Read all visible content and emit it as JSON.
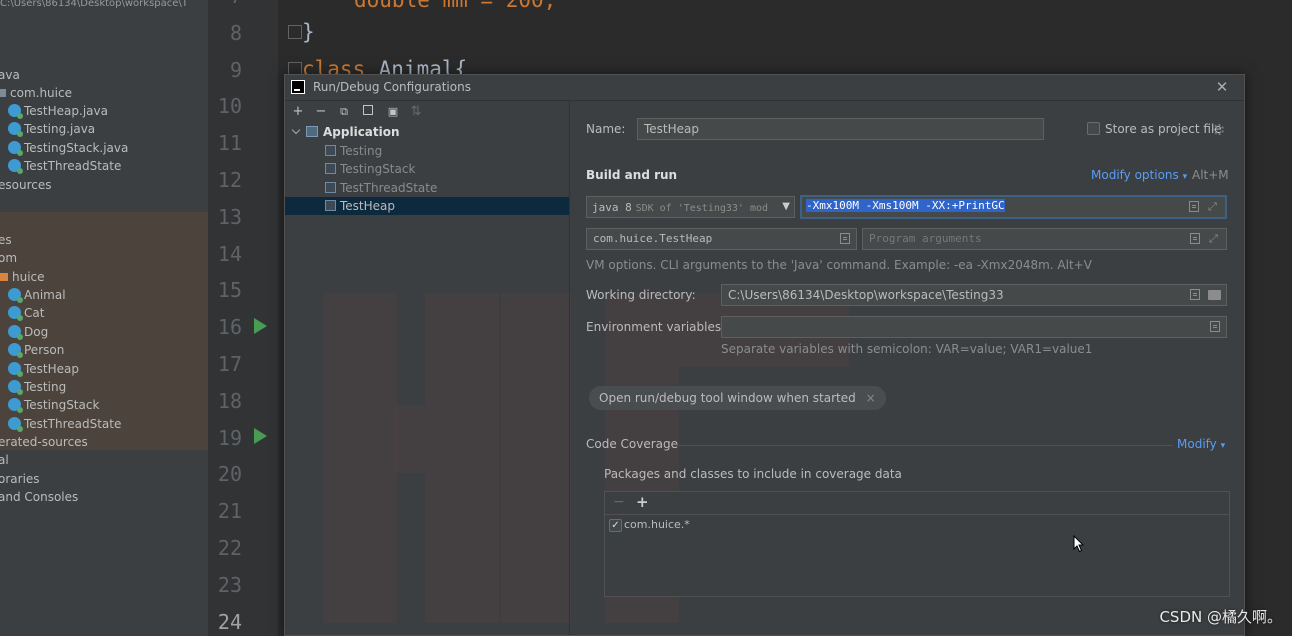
{
  "project_tree": {
    "path_text": "C:\\Users\\86134\\Desktop\\workspace\\T",
    "rows": [
      {
        "text": "ava",
        "kind": "plain"
      },
      {
        "text": "com.huice",
        "kind": "plain"
      },
      {
        "text": "TestHeap.java",
        "kind": "java"
      },
      {
        "text": "Testing.java",
        "kind": "java"
      },
      {
        "text": "TestingStack.java",
        "kind": "java"
      },
      {
        "text": "TestThreadState",
        "kind": "java"
      },
      {
        "text": "esources",
        "kind": "plain"
      },
      {
        "text": "es",
        "kind": "plain"
      },
      {
        "text": "om",
        "kind": "plain"
      },
      {
        "text": "huice",
        "kind": "folder"
      },
      {
        "text": "Animal",
        "kind": "java"
      },
      {
        "text": "Cat",
        "kind": "java"
      },
      {
        "text": "Dog",
        "kind": "java"
      },
      {
        "text": "Person",
        "kind": "java"
      },
      {
        "text": "TestHeap",
        "kind": "java"
      },
      {
        "text": "Testing",
        "kind": "java"
      },
      {
        "text": "TestingStack",
        "kind": "java"
      },
      {
        "text": "TestThreadState",
        "kind": "java"
      },
      {
        "text": "erated-sources",
        "kind": "plain"
      },
      {
        "text": "al",
        "kind": "plain"
      },
      {
        "text": "oraries",
        "kind": "plain"
      },
      {
        "text": "and Consoles",
        "kind": "plain"
      }
    ]
  },
  "editor": {
    "line_numbers": [
      "7",
      "8",
      "9",
      "10",
      "11",
      "12",
      "13",
      "14",
      "15",
      "16",
      "17",
      "18",
      "19",
      "20",
      "21",
      "22",
      "23",
      "24"
    ],
    "code_top": "double mm = 200;",
    "code_brace": "}",
    "code_class_kw": "class",
    "code_class_name": " Animal{"
  },
  "dialog": {
    "title": "Run/Debug Configurations",
    "close_glyph": "✕",
    "toolbar": {
      "add": "+",
      "remove": "−",
      "copy": "⧉",
      "save": "💾",
      "folder": "▣",
      "sort": "⇅"
    },
    "tree": {
      "group": "Application",
      "items": [
        "Testing",
        "TestingStack",
        "TestThreadState",
        "TestHeap"
      ],
      "selected": "TestHeap"
    },
    "form": {
      "name_label": "Name:",
      "name_value": "TestHeap",
      "store_label": "Store as project file",
      "build_run_label": "Build and run",
      "modify_options_label": "Modify options",
      "modify_options_shortcut": "Alt+M",
      "jdk_version": "java 8",
      "jdk_detail": "SDK of 'Testing33' mod",
      "vm_options": "-Xmx100M -Xms100M -XX:+PrintGC",
      "main_class": "com.huice.TestHeap",
      "program_args_placeholder": "Program arguments",
      "vm_hint": "VM options. CLI arguments to the 'Java' command. Example: -ea -Xmx2048m. Alt+V",
      "working_dir_label": "Working directory:",
      "working_dir_value": "C:\\Users\\86134\\Desktop\\workspace\\Testing33",
      "env_label": "Environment variables:",
      "env_value": "",
      "env_hint": "Separate variables with semicolon: VAR=value; VAR1=value1",
      "chip_label": "Open run/debug tool window when started",
      "chip_close": "×",
      "coverage_label": "Code Coverage",
      "modify_label": "Modify",
      "packages_label": "Packages and classes to include in coverage data",
      "coverage_remove": "−",
      "coverage_add": "+",
      "coverage_item": "com.huice.*",
      "coverage_item_checked": true
    }
  },
  "watermark_text": "CSDN @橘久啊。"
}
